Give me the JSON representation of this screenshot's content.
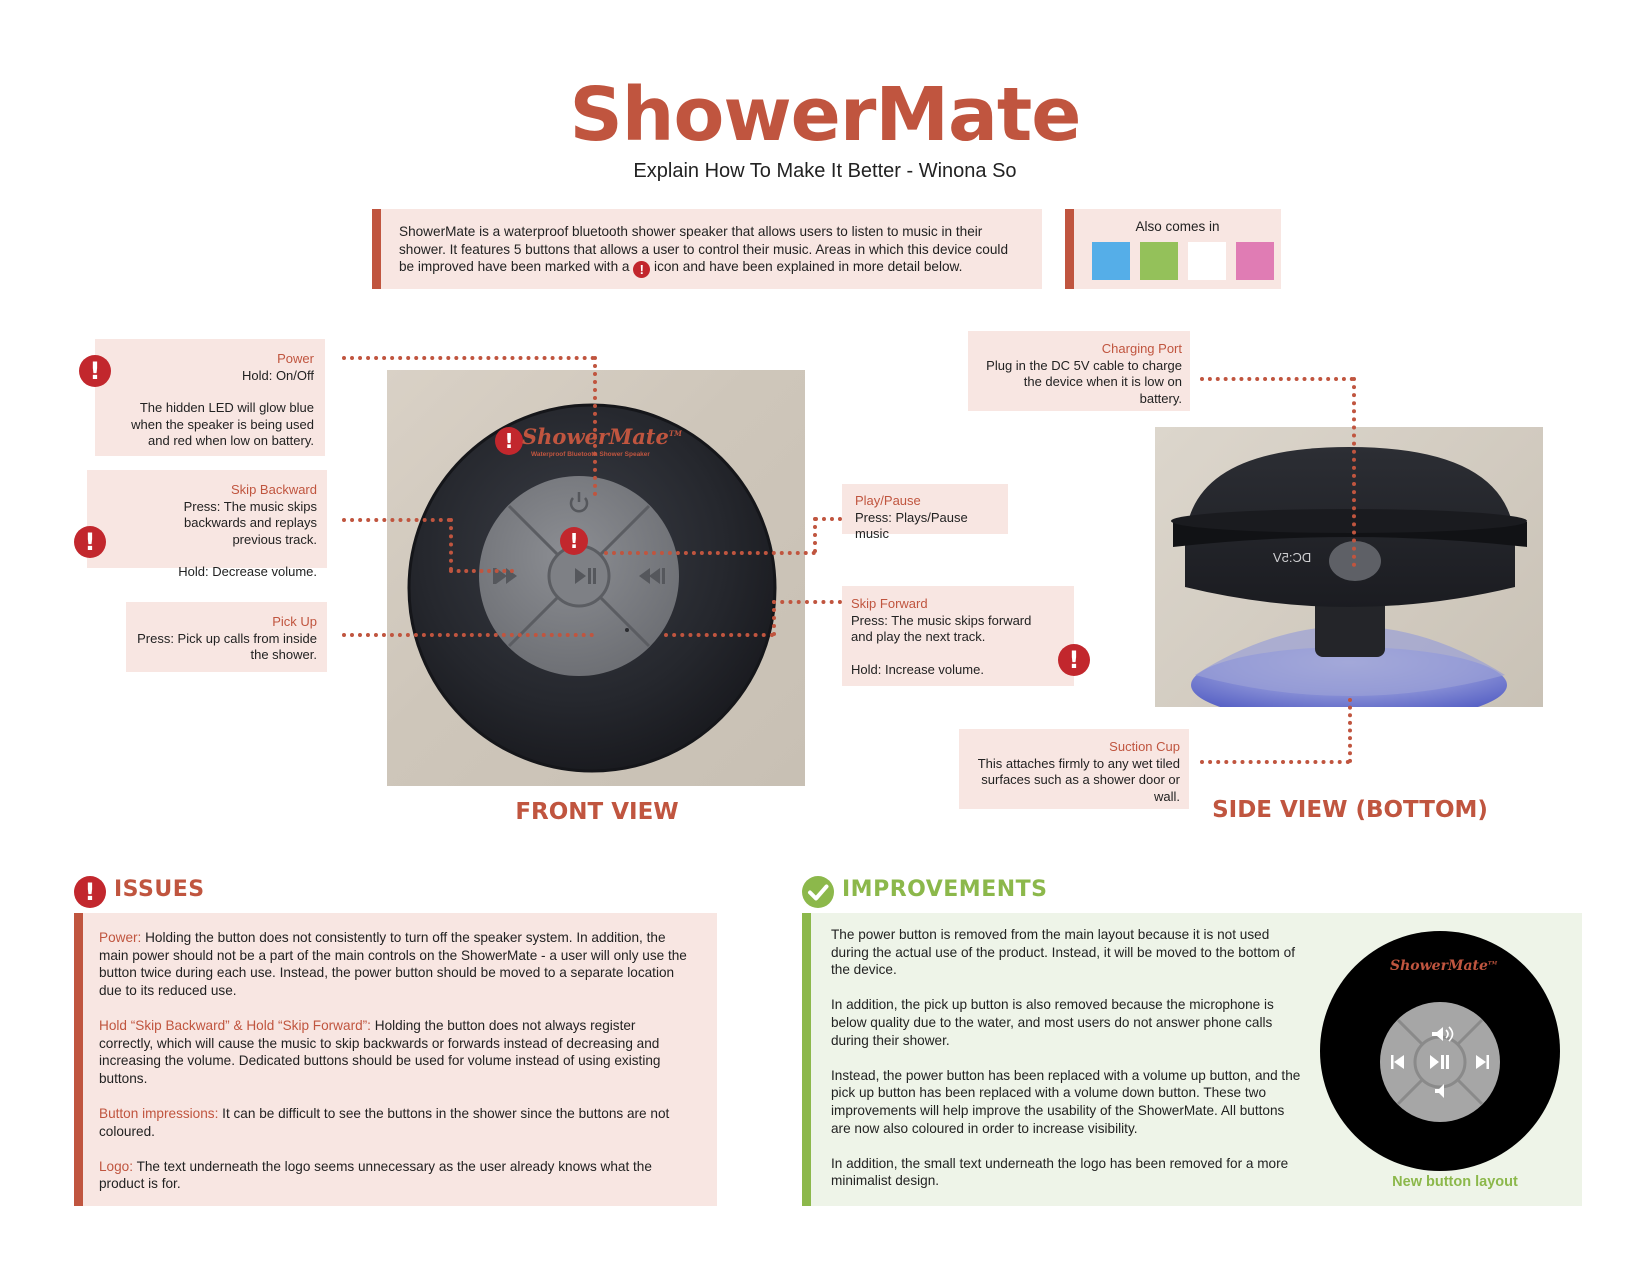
{
  "header": {
    "title": "ShowerMate",
    "subtitle": "Explain How To Make It Better - Winona So"
  },
  "intro": {
    "text_before": "ShowerMate is a waterproof bluetooth shower speaker that allows users to listen to music in their shower. It features 5 buttons that allows a user to control their music. Areas in which this device could be improved have been marked with a",
    "text_after": "icon and have been explained in more detail below."
  },
  "colors": {
    "label": "Also comes in",
    "swatches": [
      "#55aee8",
      "#94c15a",
      "#ffffff",
      "#e07cb4"
    ]
  },
  "icons": {
    "alert": "!",
    "check": "check-icon"
  },
  "callouts": {
    "power": {
      "title": "Power",
      "line1": "Hold: On/Off",
      "line2": "The hidden LED will glow blue when the speaker is being used and red when low on battery."
    },
    "skip_backward": {
      "title": "Skip Backward",
      "line1": "Press: The music skips backwards and replays previous track.",
      "line2": "Hold: Decrease volume."
    },
    "pick_up": {
      "title": "Pick Up",
      "line1": "Press: Pick up calls from inside the shower."
    },
    "play_pause": {
      "title": "Play/Pause",
      "line1": "Press: Plays/Pause music"
    },
    "skip_forward": {
      "title": "Skip Forward",
      "line1": "Press: The music skips forward and play the next track.",
      "line2": "Hold: Increase volume."
    },
    "charging_port": {
      "title": "Charging Port",
      "line1": "Plug in the DC 5V cable to charge the device when it is low on battery."
    },
    "suction_cup": {
      "title": "Suction Cup",
      "line1": "This attaches firmly to any wet tiled surfaces such as a shower door or wall."
    }
  },
  "photo_front": {
    "logo": "ShowerMate",
    "logo_tm": "TM",
    "tagline": "Waterproof Bluetooth Shower Speaker"
  },
  "photo_side": {
    "port_label": "DC:5V"
  },
  "views": {
    "front": "FRONT VIEW",
    "side": "SIDE VIEW (BOTTOM)"
  },
  "issues": {
    "title": "ISSUES",
    "items": [
      {
        "key": "Power:",
        "text": "Holding the button does not consistently to turn off the speaker system. In addition, the main power should not be a part of the main controls on the ShowerMate - a user will only use the button twice during each use. Instead, the power button should be moved to a separate location due to its reduced use."
      },
      {
        "key": "Hold “Skip Backward” & Hold “Skip Forward”:",
        "text": "Holding the button does not always register correctly, which will cause the music to skip backwards or forwards instead of decreasing and increasing the volume. Dedicated buttons should be used for volume instead of using existing buttons."
      },
      {
        "key": "Button impressions:",
        "text": "It can be difficult to see the buttons in the shower since the buttons are not coloured."
      },
      {
        "key": "Logo:",
        "text": "The text underneath the logo seems unnecessary as the user already knows what the product is for."
      }
    ]
  },
  "improvements": {
    "title": "IMPROVEMENTS",
    "paragraphs": [
      "The power button is removed from the main layout because it is not used during the actual use of the product. Instead, it will be moved to the bottom of the device.",
      "In addition, the pick up button is also removed because the microphone is below quality due to the water, and most users do not answer phone calls during their shower.",
      "Instead, the power button has been replaced with a volume up button, and the pick up button has been replaced with a volume down button. These two improvements will help improve the usability of the ShowerMate.  All buttons are now also coloured in order to increase visibility.",
      "In addition, the small text underneath the logo has been removed for a more minimalist design."
    ],
    "new_logo": "ShowerMate",
    "new_logo_tm": "TM",
    "new_layout_label": "New button layout"
  }
}
